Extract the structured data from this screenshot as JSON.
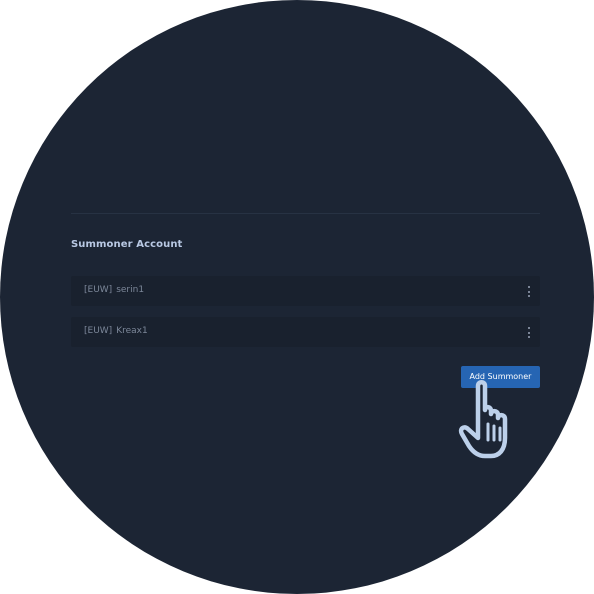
{
  "section": {
    "title": "Summoner Account"
  },
  "accounts": [
    {
      "region": "[EUW]",
      "name": "serin1"
    },
    {
      "region": "[EUW]",
      "name": "Kreax1"
    }
  ],
  "add_button": {
    "label": "Add Summoner"
  },
  "icons": {
    "row_menu": "kebab-menu-icon",
    "cursor": "pointing-hand-cursor-icon"
  },
  "colors": {
    "background": "#1c2534",
    "row_background": "#19212e",
    "accent": "#2665b3",
    "title_text": "#b9c9e4",
    "row_text": "#7c8799"
  }
}
